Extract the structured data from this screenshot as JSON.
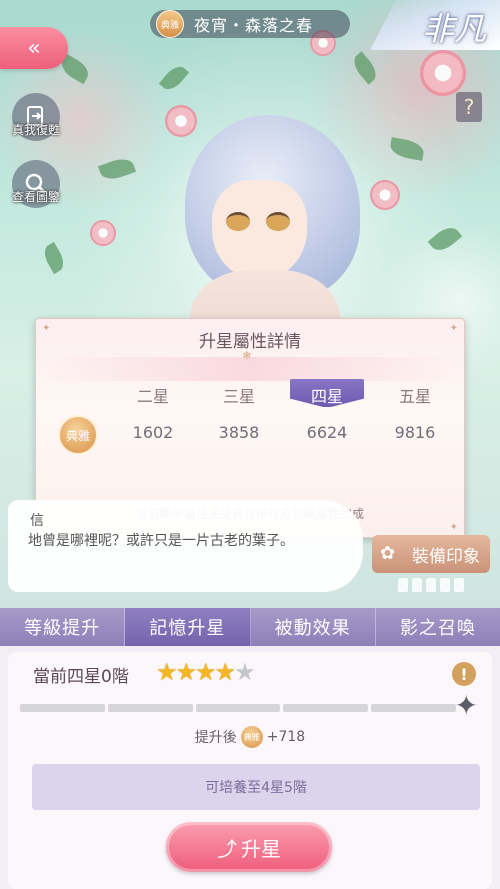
{
  "header": {
    "back_icon": "«",
    "badge_label": "典雅",
    "title": "夜宵・森落之春",
    "rarity": "非凡"
  },
  "side": {
    "revive_label": "真我復甦",
    "gallery_label": "查看圖鑒",
    "help_icon": "?"
  },
  "panel": {
    "title": "升星屬性詳情",
    "columns": [
      "二星",
      "三星",
      "四星",
      "五星"
    ],
    "active_column": "四星",
    "attribute_label": "典雅",
    "values": [
      "1602",
      "3858",
      "6624",
      "9816"
    ],
    "note": "當前顯示屬性未受真我復甦及館藏屬性加成"
  },
  "dialog": {
    "line1": "信",
    "line2": "地曾是哪裡呢？或許只是一片古老的葉子。"
  },
  "equip_button": "裝備印象",
  "tabs": [
    "等級提升",
    "記憶升星",
    "被動效果",
    "影之召喚"
  ],
  "active_tab": "記憶升星",
  "content": {
    "current_level": "當前四星0階",
    "stars_filled": 4,
    "stars_total": 5,
    "after_label": "提升後",
    "after_badge": "典雅",
    "after_value": "+718",
    "cultivate_text": "可培養至4星5階",
    "upgrade_button": "升星",
    "info_icon": "!"
  },
  "colors": {
    "accent_pink": "#ee5f7c",
    "tab_purple": "#8e80b9",
    "star_gold": "#f4b624"
  }
}
